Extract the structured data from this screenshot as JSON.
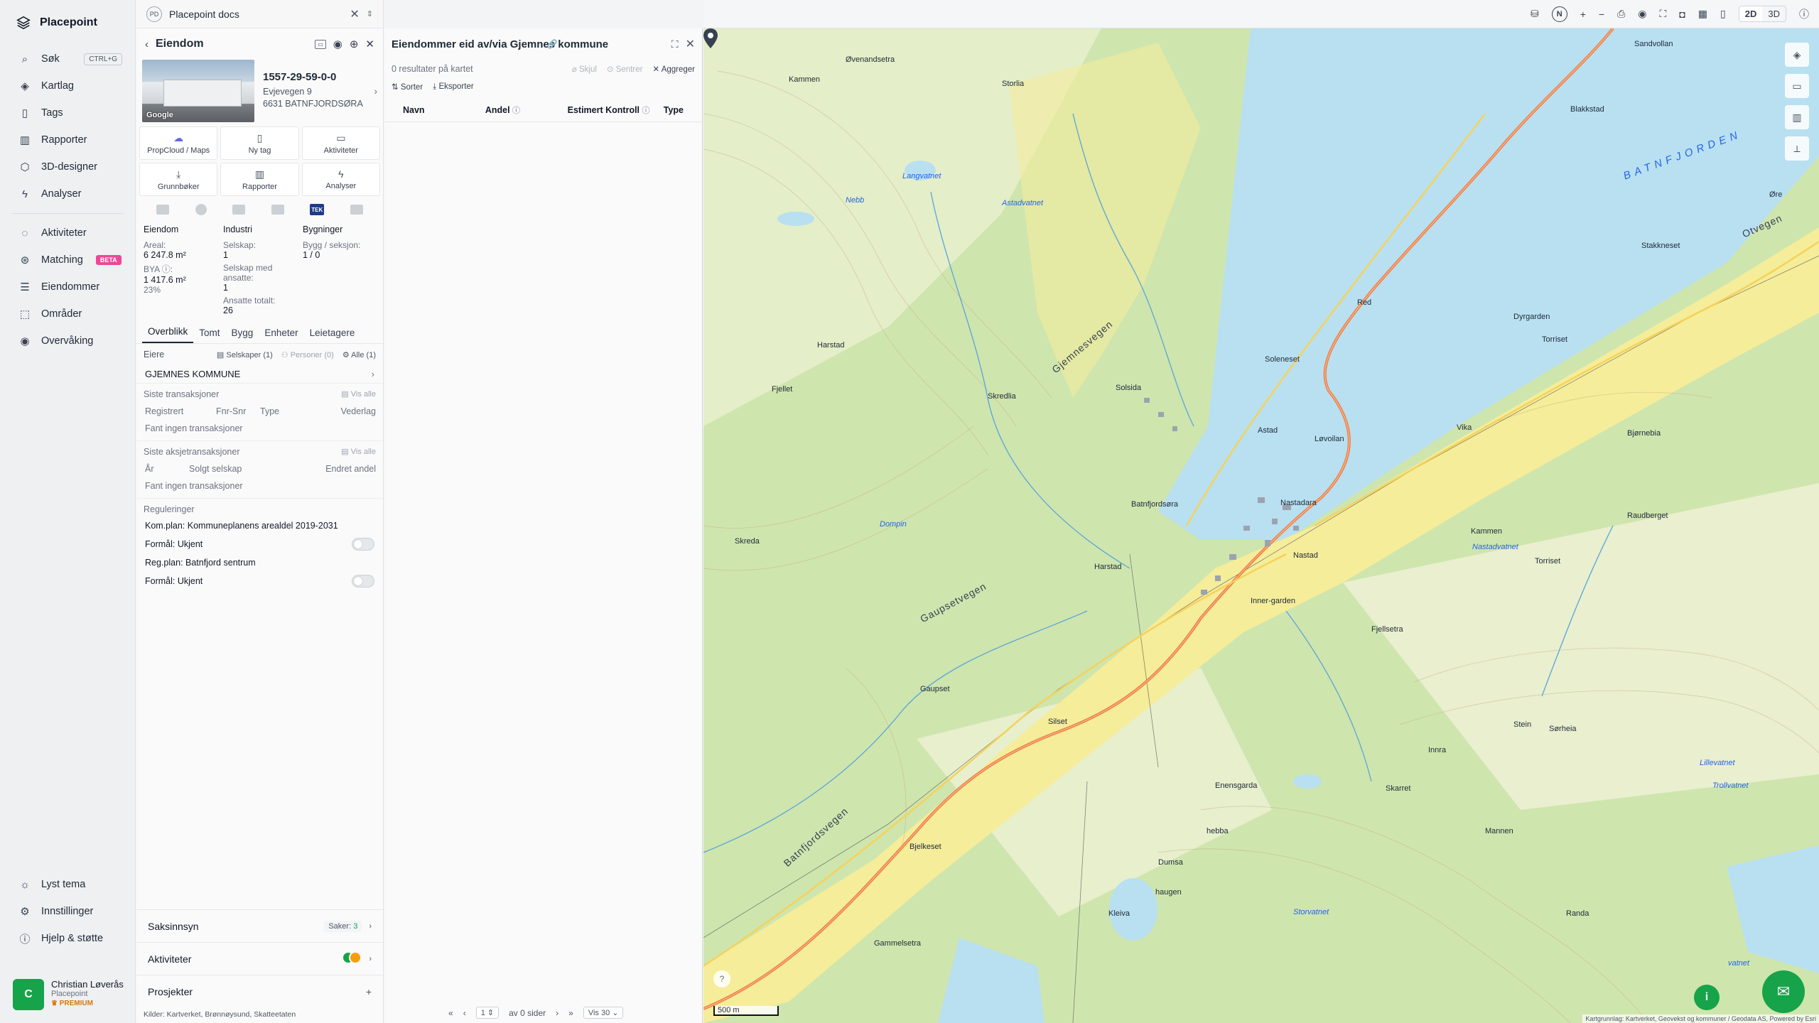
{
  "app": {
    "name": "Placepoint"
  },
  "nav": {
    "items": [
      {
        "label": "Søk",
        "shortcut": "CTRL+G"
      },
      {
        "label": "Kartlag"
      },
      {
        "label": "Tags"
      },
      {
        "label": "Rapporter"
      },
      {
        "label": "3D-designer"
      },
      {
        "label": "Analyser"
      },
      {
        "label": "Aktiviteter"
      },
      {
        "label": "Matching",
        "badge": "BETA"
      },
      {
        "label": "Eiendommer"
      },
      {
        "label": "Områder"
      },
      {
        "label": "Overvåking"
      }
    ],
    "bottom": [
      {
        "label": "Lyst tema"
      },
      {
        "label": "Innstillinger"
      },
      {
        "label": "Hjelp & støtte"
      }
    ],
    "user": {
      "initial": "C",
      "name": "Christian Løverås",
      "org": "Placepoint",
      "plan": "PREMIUM"
    }
  },
  "docs": {
    "badge": "PD",
    "title": "Placepoint docs"
  },
  "property": {
    "header": "Eiendom",
    "id": "1557-29-59-0-0",
    "address1": "Evjevegen 9",
    "address2": "6631 BATNFJORDSØRA",
    "photo_credit": "Google",
    "actions": [
      "PropCloud / Maps",
      "Ny tag",
      "Aktiviteter",
      "Grunnbøker",
      "Rapporter",
      "Analyser"
    ],
    "source_tek": "TEK",
    "facts": {
      "eiendom": {
        "heading": "Eiendom",
        "areal_label": "Areal:",
        "areal": "6 247.8 m²",
        "bya_label": "BYA ⓘ:",
        "bya": "1 417.6 m²",
        "bya_pct": "23%"
      },
      "industri": {
        "heading": "Industri",
        "selskap_label": "Selskap:",
        "selskap": "1",
        "ansatte_label": "Selskap med ansatte:",
        "ansatte": "1",
        "total_label": "Ansatte totalt:",
        "total": "26"
      },
      "bygninger": {
        "heading": "Bygninger",
        "bygg_label": "Bygg / seksjon:",
        "bygg": "1 / 0"
      }
    },
    "tabs": [
      "Overblikk",
      "Tomt",
      "Bygg",
      "Enheter",
      "Leietagere"
    ],
    "owners": {
      "label": "Eiere",
      "filters": [
        "Selskaper (1)",
        "Personer (0)",
        "Alle (1)"
      ],
      "rows": [
        "GJEMNES KOMMUNE"
      ]
    },
    "transactions": {
      "title": "Siste transaksjoner",
      "see_all": "Vis alle",
      "columns": [
        "Registrert",
        "Fnr-Snr",
        "Type",
        "Vederlag"
      ],
      "empty": "Fant ingen transaksjoner"
    },
    "share_transactions": {
      "title": "Siste aksjetransaksjoner",
      "see_all": "Vis alle",
      "columns": [
        "År",
        "Solgt selskap",
        "Endret andel"
      ],
      "empty": "Fant ingen transaksjoner"
    },
    "regulations": {
      "title": "Reguleringer",
      "lines": [
        "Kom.plan: Kommuneplanens arealdel 2019-2031",
        "Formål: Ukjent",
        "Reg.plan: Batnfjord sentrum",
        "Formål: Ukjent"
      ]
    },
    "bottom": {
      "saksinnsyn": "Saksinnsyn",
      "saker_label": "Saker:",
      "saker": "3",
      "aktiviteter": "Aktiviteter",
      "prosjekter": "Prosjekter"
    },
    "sources": "Kilder: Kartverket, Brønnøysund, Skatteetaten"
  },
  "results": {
    "title": "Eiendommer eid av/via Gjemnes kommune",
    "count_text": "0 resultater på kartet",
    "tools": [
      "Skjul",
      "Sentrer",
      "Aggreger"
    ],
    "actions": [
      "Sorter",
      "Eksporter"
    ],
    "columns": [
      "Navn",
      "Andel",
      "Estimert Kontroll",
      "Type"
    ],
    "pager": {
      "page": "1",
      "of": "av 0 sider",
      "per_page": "Vis 30"
    }
  },
  "map": {
    "view_modes": [
      "2D",
      "3D"
    ],
    "compass": "N",
    "scale": "500 m",
    "labels": {
      "fjord": "BATNFJORDEN",
      "places": [
        "Øvenandsetra",
        "Kammen",
        "Storlia",
        "Sandvollan",
        "Blakkstad",
        "Harstad",
        "Solsida",
        "Soleneset",
        "Red",
        "Dyrgarden",
        "Torriset",
        "Stakkneset",
        "Øre",
        "Astad",
        "Løvoilan",
        "Vika",
        "Bjørnebia",
        "Batnfjordsøra",
        "Nastadara",
        "Nastad",
        "Raudberget",
        "Kammen",
        "Harstad",
        "Gaupset",
        "Silset",
        "Fjellsetra",
        "Inner-garden",
        "Torriset",
        "Stein",
        "Sørheia",
        "Innra",
        "Enensgarda",
        "Skarret",
        "hebba",
        "Mannen",
        "Bjelkeset",
        "Dumsa",
        "haugen",
        "Kleiva",
        "Gammelsetra",
        "Randa",
        "Fjellet",
        "Skreda",
        "Skredlia"
      ],
      "water": [
        "Langvatnet",
        "Nebb",
        "Astadvatnet",
        "Dompin",
        "Nastadvatnet",
        "Storvatnet",
        "Lillevatnet",
        "Trollvatnet",
        "vatnet"
      ],
      "roads": [
        "Gjemnesvegen",
        "Gaupsetvegen",
        "Batnfjordsvegen",
        "Otvegen"
      ]
    },
    "attribution": "Kartgrunnlag: Kartverket, Geovekst og kommuner / Geodata AS, Powered by Esri"
  }
}
